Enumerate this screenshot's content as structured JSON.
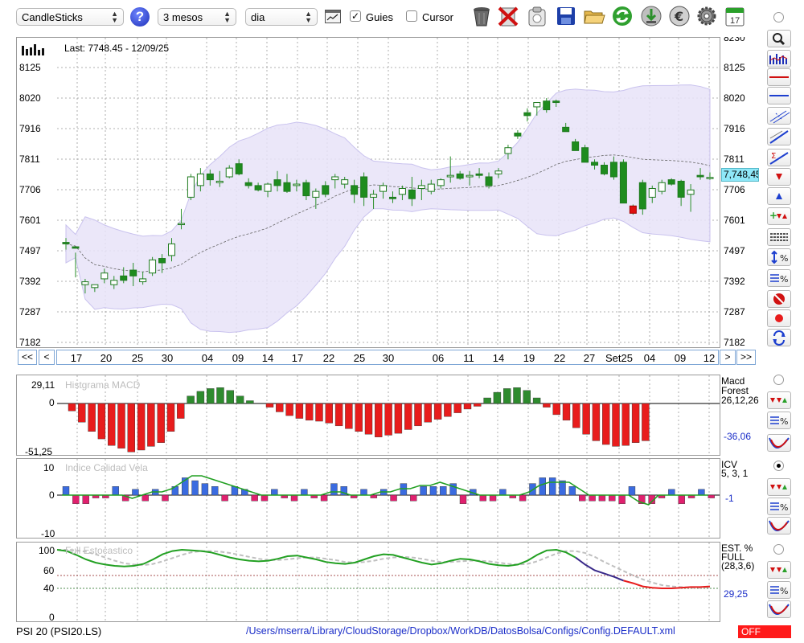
{
  "toolbar": {
    "chart_type": "CandleSticks",
    "period": "3 mesos",
    "interval": "dia",
    "guides_label": "Guies",
    "guides_checked": true,
    "cursor_label": "Cursor",
    "cursor_checked": false,
    "icons": [
      "help-icon",
      "chart-window-icon",
      "trash-icon",
      "delete-icon",
      "clipboard-icon",
      "save-icon",
      "open-folder-icon",
      "refresh-icon",
      "download-icon",
      "euro-icon",
      "settings-icon",
      "calendar-icon"
    ],
    "calendar_day": "17"
  },
  "main_chart": {
    "last_label": "Last: 7748.45 - 12/09/25",
    "y_labels": [
      "8125",
      "8020",
      "7916",
      "7811",
      "7706",
      "7601",
      "7497",
      "7392",
      "7287",
      "7182"
    ],
    "y_label_top_cut": "8230",
    "current_price": "7,748,45",
    "x_labels": [
      "17",
      "20",
      "25",
      "30",
      "04",
      "09",
      "14",
      "17",
      "22",
      "25",
      "30",
      "06",
      "11",
      "14",
      "19",
      "22",
      "27",
      "Set25",
      "04",
      "09",
      "12"
    ],
    "nav": {
      "first": "<<",
      "prev": "<",
      "next": ">",
      "last": ">>"
    },
    "colors": {
      "up": "#ffffff",
      "down": "#1e8c1e",
      "bands": "#e7e3f8",
      "bands_edge": "#c9c2ee",
      "current_box": "#8fe8f8"
    }
  },
  "macd": {
    "title": "Histgrama MACD",
    "y_top": "29,11",
    "y_zero": "0",
    "y_bottom": "-51,25",
    "legend_line1": "Macd",
    "legend_line2": "Forest",
    "params": "26,12,26",
    "value": "-36,06",
    "colors": {
      "positive": "#2e8b2e",
      "negative": "#e81c1c"
    }
  },
  "icv": {
    "title": "Indice Calidad Vela",
    "y_top": "10",
    "y_zero": "0",
    "y_bottom": "-10",
    "legend_line1": "ICV",
    "params": "5, 3, 1",
    "value": "-1",
    "colors": {
      "positive": "#3a6be0",
      "negative": "#e0206e",
      "line": "#22a022"
    }
  },
  "stochastic": {
    "title": "Full Estocastico",
    "y_labels": [
      "100",
      "60",
      "40",
      "0"
    ],
    "legend_line1": "EST. %",
    "legend_line2": "FULL",
    "params": "(28,3,6)",
    "value": "29,25",
    "colors": {
      "k": "#22a022",
      "d": "#c0c0c0",
      "falling": "#e81c1c",
      "mid": "#3a2a8a"
    }
  },
  "status": {
    "symbol": "PSI 20 (PSI20.LS)",
    "path": "/Users/mserra/Library/CloudStorage/Dropbox/WorkDB/DatosBolsa/Configs/Config.DEFAULT.xml",
    "off": "OFF"
  },
  "candles": [
    [
      7525,
      7540,
      7500,
      7520
    ],
    [
      7510,
      7490,
      7405,
      7505
    ],
    [
      7380,
      7400,
      7350,
      7390
    ],
    [
      7370,
      7375,
      7355,
      7380
    ],
    [
      7400,
      7435,
      7385,
      7420
    ],
    [
      7380,
      7410,
      7365,
      7395
    ],
    [
      7410,
      7440,
      7385,
      7395
    ],
    [
      7430,
      7455,
      7375,
      7410
    ],
    [
      7390,
      7425,
      7380,
      7400
    ],
    [
      7420,
      7475,
      7410,
      7465
    ],
    [
      7470,
      7485,
      7420,
      7455
    ],
    [
      7480,
      7540,
      7460,
      7520
    ],
    [
      7590,
      7640,
      7570,
      7590
    ],
    [
      7680,
      7760,
      7670,
      7750
    ],
    [
      7720,
      7780,
      7700,
      7760
    ],
    [
      7760,
      7775,
      7720,
      7740
    ],
    [
      7730,
      7770,
      7715,
      7735
    ],
    [
      7750,
      7790,
      7745,
      7780
    ],
    [
      7795,
      7810,
      7755,
      7760
    ],
    [
      7730,
      7745,
      7710,
      7720
    ],
    [
      7720,
      7730,
      7700,
      7705
    ],
    [
      7700,
      7730,
      7680,
      7725
    ],
    [
      7740,
      7770,
      7700,
      7720
    ],
    [
      7730,
      7760,
      7695,
      7700
    ],
    [
      7720,
      7740,
      7700,
      7725
    ],
    [
      7730,
      7740,
      7670,
      7685
    ],
    [
      7680,
      7710,
      7640,
      7700
    ],
    [
      7720,
      7735,
      7680,
      7690
    ],
    [
      7740,
      7760,
      7710,
      7750
    ],
    [
      7725,
      7750,
      7710,
      7740
    ],
    [
      7720,
      7740,
      7660,
      7690
    ],
    [
      7750,
      7765,
      7650,
      7680
    ],
    [
      7680,
      7705,
      7640,
      7690
    ],
    [
      7700,
      7730,
      7675,
      7720
    ],
    [
      7680,
      7700,
      7660,
      7675
    ],
    [
      7690,
      7720,
      7670,
      7710
    ],
    [
      7705,
      7750,
      7650,
      7675
    ],
    [
      7710,
      7740,
      7670,
      7720
    ],
    [
      7700,
      7740,
      7690,
      7725
    ],
    [
      7720,
      7745,
      7710,
      7740
    ],
    [
      7750,
      7820,
      7730,
      7755
    ],
    [
      7760,
      7770,
      7740,
      7745
    ],
    [
      7750,
      7770,
      7720,
      7755
    ],
    [
      7760,
      7780,
      7745,
      7755
    ],
    [
      7750,
      7765,
      7710,
      7720
    ],
    [
      7760,
      7780,
      7745,
      7770
    ],
    [
      7830,
      7860,
      7810,
      7850
    ],
    [
      7900,
      7910,
      7880,
      7890
    ],
    [
      7970,
      7985,
      7940,
      7960
    ],
    [
      7990,
      8005,
      7960,
      8005
    ],
    [
      8010,
      8020,
      7970,
      7980
    ],
    [
      8010,
      8015,
      7990,
      8005
    ],
    [
      7920,
      7935,
      7905,
      7905
    ],
    [
      7870,
      7880,
      7840,
      7840
    ],
    [
      7850,
      7860,
      7800,
      7800
    ],
    [
      7800,
      7810,
      7775,
      7790
    ],
    [
      7790,
      7800,
      7755,
      7760
    ],
    [
      7800,
      7820,
      7740,
      7750
    ],
    [
      7800,
      7810,
      7660,
      7660
    ],
    [
      7650,
      7655,
      7620,
      7625
    ],
    [
      7730,
      7740,
      7620,
      7640
    ],
    [
      7680,
      7720,
      7660,
      7710
    ],
    [
      7700,
      7740,
      7690,
      7730
    ],
    [
      7740,
      7745,
      7720,
      7725
    ],
    [
      7735,
      7740,
      7650,
      7680
    ],
    [
      7690,
      7725,
      7630,
      7705
    ],
    [
      7755,
      7780,
      7740,
      7750
    ],
    [
      7745,
      7765,
      7740,
      7748
    ]
  ]
}
